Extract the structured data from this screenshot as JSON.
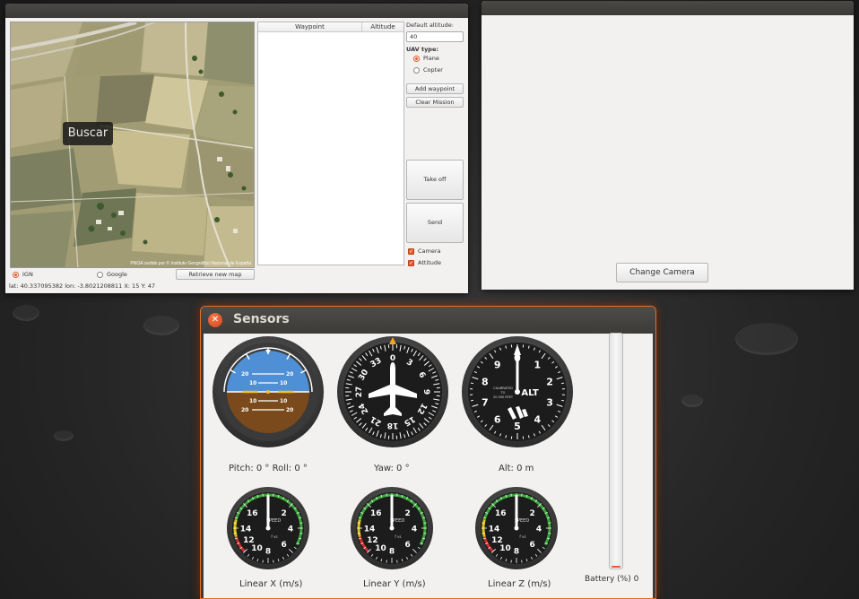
{
  "mission": {
    "map": {
      "search_label": "Buscar",
      "attribution": "PNOA cedido por © Instituto Geográfico Nacional de España"
    },
    "table": {
      "col_waypoint": "Waypoint",
      "col_altitude": "Altitude"
    },
    "default_altitude_label": "Default altitude:",
    "default_altitude_value": "40",
    "uav_type_label": "UAV type:",
    "uav_plane": "Plane",
    "uav_copter": "Copter",
    "add_waypoint": "Add waypoint",
    "clear_mission": "Clear Mission",
    "take_off": "Take off",
    "send": "Send",
    "camera_check": "Camera",
    "attitude_check": "Attitude",
    "source_ign": "IGN",
    "source_google": "Google",
    "retrieve_map": "Retrieve new map",
    "coords": "lat: 40.337095382 lon: -3.8021208811 X: 15 Y: 47"
  },
  "camera": {
    "change_camera": "Change Camera"
  },
  "sensors": {
    "title": "Sensors",
    "close_icon": "close-icon",
    "pitch_roll": "Pitch:  0 °  Roll:  0 °",
    "yaw": "Yaw:  0 °",
    "alt": "Alt:  0  m",
    "linear_x": "Linear X (m/s)",
    "linear_y": "Linear Y (m/s)",
    "linear_z": "Linear Z (m/s)",
    "battery_label": "Battery (%)  0",
    "battery_percent": 0,
    "attitude_marks": [
      "20",
      "10",
      "10",
      "20"
    ],
    "altimeter": {
      "digits": [
        "0",
        "1",
        "2",
        "3",
        "4",
        "5",
        "6",
        "7",
        "8",
        "9"
      ],
      "center_text": "ALT",
      "small_text": [
        "CALIBRATED",
        "TO",
        "20 000 FEET"
      ]
    },
    "heading_labels": [
      "0",
      "3",
      "6",
      "9",
      "12",
      "15",
      "18",
      "21",
      "24",
      "27",
      "30",
      "33"
    ],
    "speed_ticks": [
      "16",
      "2",
      "4",
      "6",
      "8",
      "10",
      "12",
      "14"
    ],
    "speed_center": "SPEED",
    "speed_sub": "f vs",
    "colors": {
      "accent": "#e05a2b",
      "sky": "#4f8fd6",
      "ground": "#7a4a1c",
      "speed_red": "#d32f2f",
      "speed_yellow": "#e0c21b",
      "speed_green": "#3aa83a"
    }
  }
}
